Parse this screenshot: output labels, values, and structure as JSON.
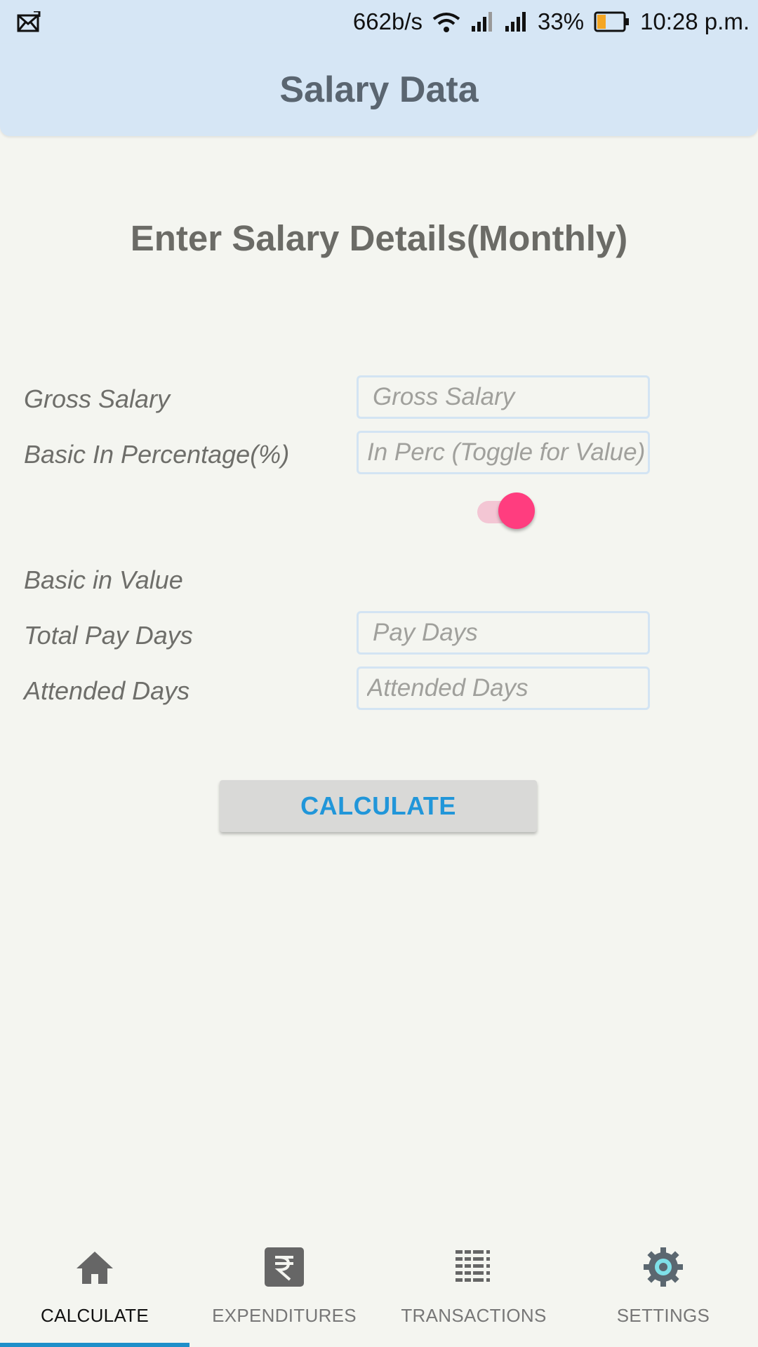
{
  "status_bar": {
    "speed": "662b/s",
    "battery_percent": "33%",
    "time": "10:28 p.m.",
    "battery_level": 0.33,
    "battery_color": "#f5a623",
    "icons": [
      "notification-icon",
      "wifi-icon",
      "signal-icon",
      "signal-icon",
      "battery-icon"
    ]
  },
  "app_bar": {
    "title": "Salary Data",
    "background": "#d6e6f5"
  },
  "form": {
    "title": "Enter Salary Details(Monthly)",
    "gross_salary": {
      "label": "Gross Salary",
      "placeholder": "Gross Salary",
      "value": ""
    },
    "basic_percentage": {
      "label": "Basic In Percentage(%)",
      "placeholder": "In Perc (Toggle for Value)",
      "value": ""
    },
    "toggle": {
      "checked": true,
      "color": "#ff3d7f"
    },
    "basic_value": {
      "label": "Basic in Value"
    },
    "pay_days": {
      "label": "Total Pay Days",
      "placeholder": "Pay Days",
      "value": ""
    },
    "attended_days": {
      "label": "Attended Days",
      "placeholder": "Attended Days",
      "value": ""
    },
    "calculate_label": "CALCULATE",
    "accent": "#2196d9"
  },
  "bottom_nav": {
    "items": [
      {
        "label": "CALCULATE",
        "icon": "home-icon",
        "active": true
      },
      {
        "label": "EXPENDITURES",
        "icon": "rupee-icon",
        "active": false
      },
      {
        "label": "TRANSACTIONS",
        "icon": "list-icon",
        "active": false
      },
      {
        "label": "SETTINGS",
        "icon": "gear-icon",
        "active": false
      }
    ],
    "indicator_color": "#1e8fc9"
  }
}
